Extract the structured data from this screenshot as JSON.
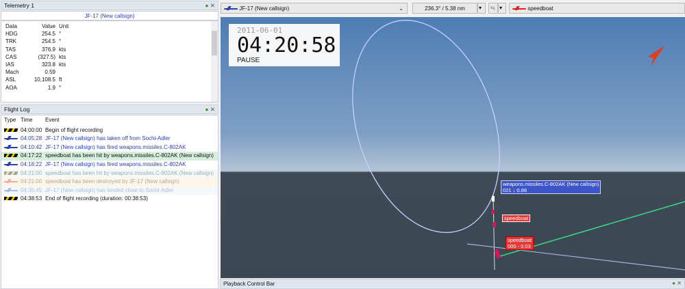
{
  "telemetry": {
    "title": "Telemetry 1",
    "callsign": "JF-17 (New callsign)",
    "columns": [
      "Data",
      "Value",
      "Unit"
    ],
    "rows": [
      [
        "HDG",
        "254.5",
        "°"
      ],
      [
        "TRK",
        "254.5",
        "°"
      ],
      [
        "TAS",
        "376.9",
        "kts"
      ],
      [
        "CAS",
        "(327.5)",
        "kts"
      ],
      [
        "IAS",
        "323.8",
        "kts"
      ],
      [
        "Mach",
        "0.59",
        ""
      ],
      [
        "ASL",
        "10,108.5",
        "ft"
      ],
      [
        "AOA",
        "1.9",
        "°"
      ]
    ]
  },
  "flight_log": {
    "title": "Flight Log",
    "columns": [
      "Type",
      "Time",
      "Event"
    ],
    "rows": [
      {
        "type": "hazard",
        "time": "04:00:00",
        "event": "Begin of flight recording",
        "state": "normal"
      },
      {
        "type": "plane-blue",
        "time": "04:05:28",
        "event": "JF-17 (New callsign) has taken off from Sochi-Adler",
        "state": "normal"
      },
      {
        "type": "plane-blue",
        "time": "04:10:42",
        "event": "JF-17 (New callsign) has fired weapons.missiles.C-802AK",
        "state": "normal"
      },
      {
        "type": "hazard",
        "time": "04:17:22",
        "event": "speedboat has been hit by weapons.missiles.C-802AK (New callsign)",
        "state": "selected"
      },
      {
        "type": "plane-blue",
        "time": "04:18:22",
        "event": "JF-17 (New callsign) has fired weapons.missiles.C-802AK",
        "state": "normal"
      },
      {
        "type": "hazard",
        "time": "04:21:00",
        "event": "speedboat has been hit by weapons.missiles.C-802AK (New callsign)",
        "state": "future"
      },
      {
        "type": "boat-red",
        "time": "04:21:00",
        "event": "speedboat has been destroyed by JF-17 (New callsign)",
        "state": "future"
      },
      {
        "type": "plane-blue",
        "time": "04:35:45",
        "event": "JF-17 (New callsign) has landed close to Sochi-Adler",
        "state": "future"
      },
      {
        "type": "hazard",
        "time": "04:38:53",
        "event": "End of flight recording (duration: 00:38:53)",
        "state": "normal"
      }
    ]
  },
  "toolbar": {
    "primary_object": "JF-17 (New callsign)",
    "bearing_range": "236.3° / 5.38 nm",
    "secondary_object": "speedboat"
  },
  "viewport": {
    "date": "2011-06-01",
    "time": "04:20:58",
    "status": "PAUSE",
    "labels": {
      "missile": "weapons.missiles.C-802AK (New callsign)",
      "missile_info": "021 ↓ 0.88",
      "boat1": "speedboat",
      "boat2": "speedboat",
      "boat2_info": "000 - 0.03"
    }
  },
  "playback": {
    "title": "Playback Control Bar"
  },
  "colors": {
    "accent_blue": "#2a3fa8",
    "hostile_red": "#e02020",
    "selected_row": "#d6efdf"
  }
}
